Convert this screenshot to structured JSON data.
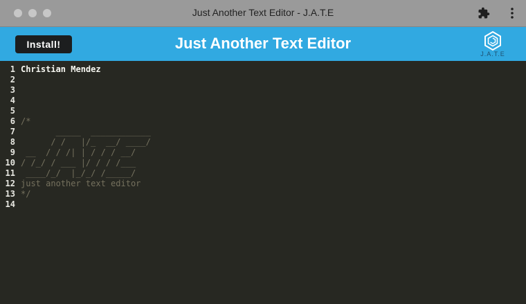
{
  "window": {
    "title": "Just Another Text Editor - J.A.T.E"
  },
  "header": {
    "install_label": "Install!",
    "app_title": "Just Another Text Editor",
    "logo_text": "J.A.T.E"
  },
  "editor": {
    "lines": [
      {
        "num": "1",
        "text": "Christian Mendez",
        "style": "bold"
      },
      {
        "num": "2",
        "text": "",
        "style": "plain"
      },
      {
        "num": "3",
        "text": "",
        "style": "plain"
      },
      {
        "num": "4",
        "text": "",
        "style": "plain"
      },
      {
        "num": "5",
        "text": "",
        "style": "plain"
      },
      {
        "num": "6",
        "text": "/*",
        "style": "comment"
      },
      {
        "num": "7",
        "text": "       _____  ____________",
        "style": "comment"
      },
      {
        "num": "8",
        "text": "      / /   |/_  __/ ____/",
        "style": "comment"
      },
      {
        "num": "9",
        "text": " __  / / /| | / / / __/",
        "style": "comment"
      },
      {
        "num": "10",
        "text": "/ /_/ / ___ |/ / / /___",
        "style": "comment"
      },
      {
        "num": "11",
        "text": " ____/_/  |_/_/ /_____/",
        "style": "comment"
      },
      {
        "num": "12",
        "text": "just another text editor",
        "style": "comment"
      },
      {
        "num": "13",
        "text": "*/",
        "style": "comment"
      },
      {
        "num": "14",
        "text": "",
        "style": "plain"
      }
    ]
  },
  "colors": {
    "titlebar": "#9a9a9a",
    "header": "#31a9e1",
    "editor_bg": "#272822",
    "comment": "#75715e",
    "text": "#f8f8f2"
  },
  "icons": [
    "extensions-puzzle-icon",
    "more-vertical-icon",
    "jate-logo-icon"
  ]
}
